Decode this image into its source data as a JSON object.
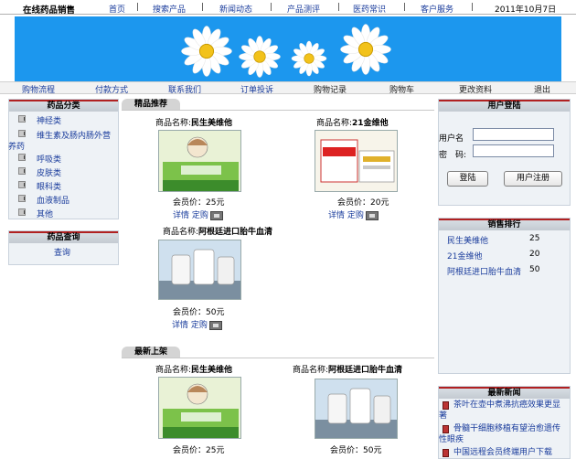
{
  "header": {
    "site_title": "在线药品销售",
    "nav": [
      "首页",
      "搜索产品",
      "新闻动态",
      "产品测评",
      "医药常识",
      "客户服务"
    ],
    "separator": "|",
    "date": "2011年10月7日"
  },
  "subnav": [
    "购物流程",
    "付款方式",
    "联系我们",
    "订单投诉",
    "购物记录",
    "购物车",
    "更改资料",
    "退出"
  ],
  "categories": {
    "title": "药品分类",
    "items": [
      "神经类",
      "维生素及肠内肠外营养药",
      "呼吸类",
      "皮肤类",
      "眼科类",
      "血液制品",
      "其他"
    ],
    "item2_line1": "维生素及肠内肠外营",
    "item2_line2": "养药"
  },
  "search_panel": {
    "title": "药品查询",
    "link": "查询"
  },
  "recommended": {
    "tab": "精品推荐",
    "products": [
      {
        "label": "商品名称:",
        "name": "民生美维他",
        "price_label": "会员价：",
        "price": "25元",
        "details": "详情",
        "order": "定购"
      },
      {
        "label": "商品名称:",
        "name": "21金维他",
        "price_label": "会员价：",
        "price": "20元",
        "details": "详情",
        "order": "定购"
      },
      {
        "label": "商品名称:",
        "name": "阿根廷进口胎牛血清",
        "price_label": "会员价：",
        "price": "50元",
        "details": "详情",
        "order": "定购"
      }
    ]
  },
  "new_arrivals": {
    "tab": "最新上架",
    "products": [
      {
        "label": "商品名称:",
        "name": "民生美维他",
        "price_label": "会员价：",
        "price": "25元"
      },
      {
        "label": "商品名称:",
        "name": "阿根廷进口胎牛血清",
        "price_label": "会员价：",
        "price": "50元"
      }
    ]
  },
  "login": {
    "title": "用户登陆",
    "username_label": "用户名",
    "password_label": "密　码:",
    "login_button": "登陆",
    "register_button": "用户注册"
  },
  "ranking": {
    "title": "销售排行",
    "items": [
      {
        "name": "民生美维他",
        "count": "25"
      },
      {
        "name": "21金维他",
        "count": "20"
      },
      {
        "name": "阿根廷进口胎牛血清",
        "count": "50"
      }
    ]
  },
  "news": {
    "title": "最新新闻",
    "items": [
      {
        "line1": "茶叶在壶中煮沸抗癌效果更显",
        "line2": "著"
      },
      {
        "line1": "骨髓干细胞移植有望治愈遗传",
        "line2": "性眼疾"
      },
      {
        "line1": "中国远程会员终端用户下载",
        "line2": ""
      }
    ]
  },
  "colors": {
    "banner": "#1c97ee",
    "link": "#1a3c9c",
    "panel_accent": "#b12020"
  }
}
